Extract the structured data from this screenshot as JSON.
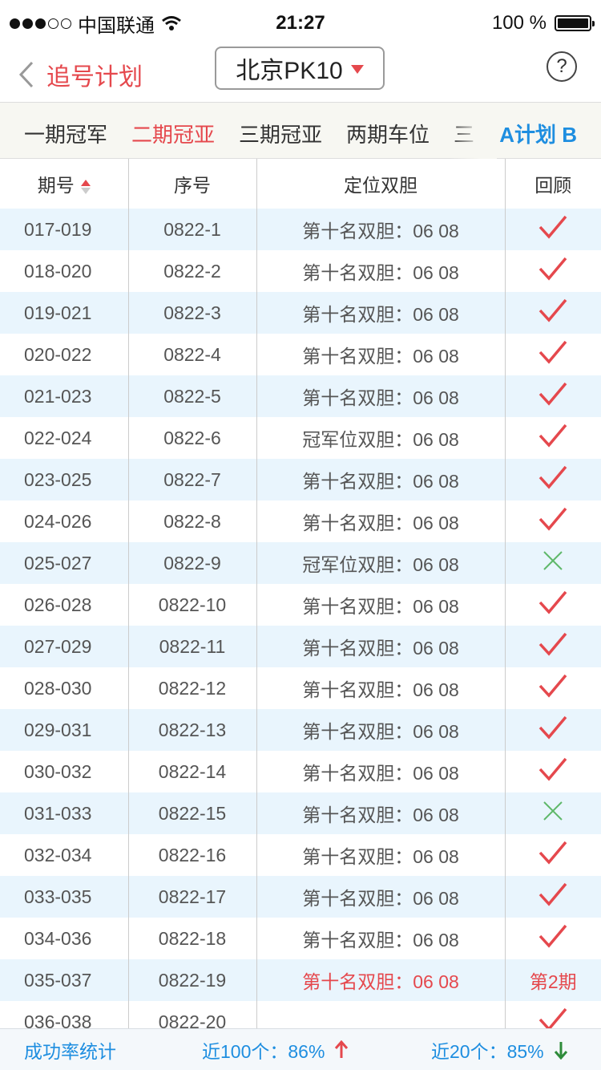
{
  "status_bar": {
    "carrier": "中国联通",
    "time": "21:27",
    "battery": "100 %",
    "battery_level": 1.0
  },
  "nav": {
    "back_label": "追号计划",
    "selector_label": "北京PK10",
    "help_label": "?"
  },
  "tabs": [
    "一期冠军",
    "二期冠亚",
    "三期冠亚",
    "两期车位",
    "三"
  ],
  "active_tab": 1,
  "plan_label": "A计划 B",
  "table": {
    "headers": [
      "期号",
      "序号",
      "定位双胆",
      "回顾"
    ],
    "rows": [
      {
        "period": "017-019",
        "seq": "0822-1",
        "pick": "第十名双胆：06  08",
        "result": "check"
      },
      {
        "period": "018-020",
        "seq": "0822-2",
        "pick": "第十名双胆：06  08",
        "result": "check"
      },
      {
        "period": "019-021",
        "seq": "0822-3",
        "pick": "第十名双胆：06  08",
        "result": "check"
      },
      {
        "period": "020-022",
        "seq": "0822-4",
        "pick": "第十名双胆：06  08",
        "result": "check"
      },
      {
        "period": "021-023",
        "seq": "0822-5",
        "pick": "第十名双胆：06  08",
        "result": "check"
      },
      {
        "period": "022-024",
        "seq": "0822-6",
        "pick": "冠军位双胆：06  08",
        "result": "check"
      },
      {
        "period": "023-025",
        "seq": "0822-7",
        "pick": "第十名双胆：06  08",
        "result": "check"
      },
      {
        "period": "024-026",
        "seq": "0822-8",
        "pick": "第十名双胆：06  08",
        "result": "check"
      },
      {
        "period": "025-027",
        "seq": "0822-9",
        "pick": "冠军位双胆：06  08",
        "result": "cross"
      },
      {
        "period": "026-028",
        "seq": "0822-10",
        "pick": "第十名双胆：06  08",
        "result": "check"
      },
      {
        "period": "027-029",
        "seq": "0822-11",
        "pick": "第十名双胆：06  08",
        "result": "check"
      },
      {
        "period": "028-030",
        "seq": "0822-12",
        "pick": "第十名双胆：06  08",
        "result": "check"
      },
      {
        "period": "029-031",
        "seq": "0822-13",
        "pick": "第十名双胆：06  08",
        "result": "check"
      },
      {
        "period": "030-032",
        "seq": "0822-14",
        "pick": "第十名双胆：06  08",
        "result": "check"
      },
      {
        "period": "031-033",
        "seq": "0822-15",
        "pick": "第十名双胆：06  08",
        "result": "cross"
      },
      {
        "period": "032-034",
        "seq": "0822-16",
        "pick": "第十名双胆：06  08",
        "result": "check"
      },
      {
        "period": "033-035",
        "seq": "0822-17",
        "pick": "第十名双胆：06  08",
        "result": "check"
      },
      {
        "period": "034-036",
        "seq": "0822-18",
        "pick": "第十名双胆：06  08",
        "result": "check"
      },
      {
        "period": "035-037",
        "seq": "0822-19",
        "pick": "第十名双胆：06  08",
        "result": "text",
        "result_text": "第2期",
        "highlight": true
      },
      {
        "period": "036-038",
        "seq": "0822-20",
        "pick": "",
        "result": "check"
      }
    ]
  },
  "footer": {
    "stats_label": "成功率统计",
    "recent100": "近100个：86%",
    "recent20": "近20个：85%"
  },
  "colors": {
    "accent_red": "#e5484d",
    "accent_blue": "#1e8ee0",
    "row_alt": "#e9f5fd",
    "trend_down": "#2e8b3a"
  }
}
